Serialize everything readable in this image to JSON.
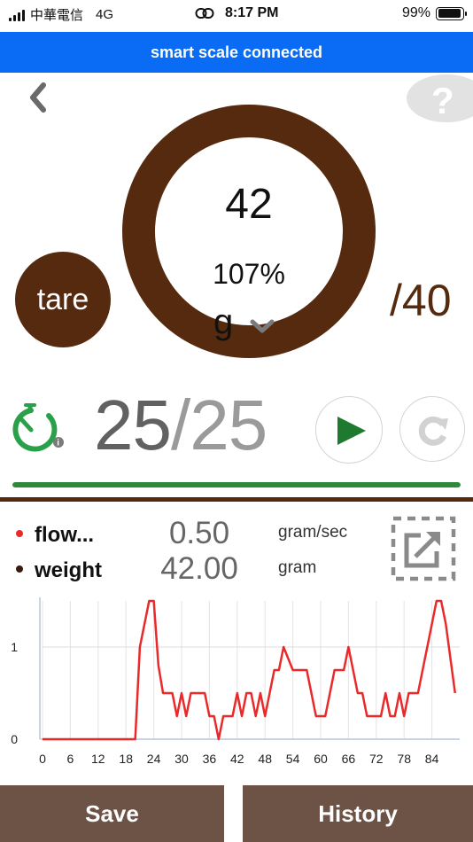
{
  "status_bar": {
    "carrier": "中華電信",
    "network": "4G",
    "time": "8:17 PM",
    "battery": "99%",
    "battery_level": 0.99
  },
  "banner": {
    "text": "smart scale connected"
  },
  "scale": {
    "weight": "42",
    "percent": "107%",
    "unit": "g",
    "target": "/40"
  },
  "tare": {
    "label": "tare"
  },
  "timer": {
    "current": "25",
    "separator": "/",
    "total": "25",
    "progress": 1.0
  },
  "help": {
    "label": "?"
  },
  "colors": {
    "brown": "#552a0f",
    "blue": "#0a6cf5",
    "green": "#2e8a3a",
    "button": "#6d5246",
    "flow_line": "#ea2a2a"
  },
  "stats": {
    "flow": {
      "label": "flow...",
      "value": "0.50",
      "unit": "gram/sec",
      "color": "#ea2a2a"
    },
    "weight": {
      "label": "weight",
      "value": "42.00",
      "unit": "gram",
      "color": "#3a1a0a"
    }
  },
  "buttons": {
    "save": "Save",
    "history": "History"
  },
  "icons": {
    "back": "chevron-left-icon",
    "help": "question-icon",
    "timer": "stopwatch-icon",
    "play": "play-icon",
    "reset": "reset-icon",
    "expand": "expand-icon",
    "unit_dropdown": "chevron-down-icon"
  },
  "chart_data": {
    "type": "line",
    "xticks": [
      0,
      6,
      12,
      18,
      24,
      30,
      36,
      42,
      48,
      54,
      60,
      66,
      72,
      78,
      84
    ],
    "yticks": [
      0,
      1
    ],
    "xlim": [
      0,
      90
    ],
    "ylim": [
      0,
      1.5
    ],
    "grid": true,
    "series": [
      {
        "color": "#ea2a2a",
        "x": [
          0,
          20,
          21,
          23,
          24,
          25,
          26,
          28,
          29,
          30,
          31,
          32,
          35,
          36,
          37,
          38,
          39,
          41,
          42,
          43,
          44,
          45,
          46,
          47,
          48,
          50,
          51,
          52,
          54,
          55,
          56,
          57,
          59,
          60,
          61,
          63,
          64,
          65,
          66,
          68,
          69,
          70,
          71,
          73,
          74,
          75,
          76,
          77,
          78,
          79,
          80,
          81,
          84,
          85,
          86,
          87,
          89
        ],
        "y": [
          0,
          0,
          1.0,
          1.5,
          1.5,
          0.8,
          0.5,
          0.5,
          0.25,
          0.5,
          0.25,
          0.5,
          0.5,
          0.25,
          0.25,
          0.0,
          0.25,
          0.25,
          0.5,
          0.25,
          0.5,
          0.5,
          0.25,
          0.5,
          0.25,
          0.75,
          0.75,
          1.0,
          0.75,
          0.75,
          0.75,
          0.75,
          0.25,
          0.25,
          0.25,
          0.75,
          0.75,
          0.75,
          1.0,
          0.5,
          0.5,
          0.25,
          0.25,
          0.25,
          0.5,
          0.25,
          0.25,
          0.5,
          0.25,
          0.5,
          0.5,
          0.5,
          1.25,
          1.5,
          1.5,
          1.25,
          0.5
        ]
      }
    ]
  }
}
